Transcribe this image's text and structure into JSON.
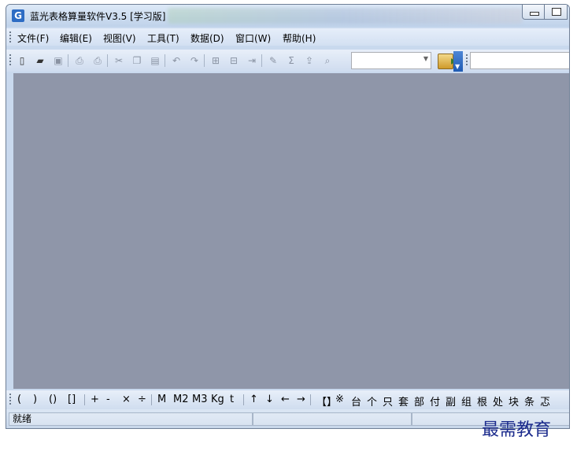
{
  "window": {
    "title": "蓝光表格算量软件V3.5 [学习版]",
    "icon_glyph": "G"
  },
  "menubar": {
    "items": [
      "文件(F)",
      "编辑(E)",
      "视图(V)",
      "工具(T)",
      "数据(D)",
      "窗口(W)",
      "帮助(H)"
    ]
  },
  "toolbar": {
    "buttons": [
      {
        "name": "new-icon",
        "glyph": "▯",
        "enabled": true
      },
      {
        "name": "open-icon",
        "glyph": "▰",
        "enabled": true
      },
      {
        "name": "save-icon",
        "glyph": "▣",
        "enabled": false
      },
      {
        "name": "print-preview-icon",
        "glyph": "⎙",
        "enabled": false
      },
      {
        "name": "print-icon",
        "glyph": "⎙",
        "enabled": false
      },
      {
        "name": "cut-icon",
        "glyph": "✂",
        "enabled": false
      },
      {
        "name": "copy-icon",
        "glyph": "❐",
        "enabled": false
      },
      {
        "name": "paste-icon",
        "glyph": "▤",
        "enabled": false
      },
      {
        "name": "undo-icon",
        "glyph": "↶",
        "enabled": false
      },
      {
        "name": "redo-icon",
        "glyph": "↷",
        "enabled": false
      },
      {
        "name": "insert-row-icon",
        "glyph": "⊞",
        "enabled": false
      },
      {
        "name": "delete-row-icon",
        "glyph": "⊟",
        "enabled": false
      },
      {
        "name": "insert-col-icon",
        "glyph": "⇥",
        "enabled": false
      },
      {
        "name": "brush-icon",
        "glyph": "✎",
        "enabled": false
      },
      {
        "name": "sum-icon",
        "glyph": "Σ",
        "enabled": false
      },
      {
        "name": "export-icon",
        "glyph": "⇪",
        "enabled": false
      },
      {
        "name": "find-icon",
        "glyph": "⌕",
        "enabled": false
      }
    ],
    "combo_value": "",
    "combo2_value": ""
  },
  "symbols": {
    "groups": [
      [
        "(",
        ")",
        "()",
        "[]"
      ],
      [
        "+",
        "-",
        "×",
        "÷"
      ],
      [
        "M",
        "M2",
        "M3",
        "Kg",
        "t"
      ],
      [
        "↑",
        "↓",
        "←",
        "→"
      ],
      [
        "【】",
        "※",
        "台",
        "个",
        "只",
        "套",
        "部",
        "付",
        "副",
        "组",
        "根",
        "处",
        "块",
        "条",
        "忑"
      ]
    ]
  },
  "status": {
    "text": "就绪"
  },
  "watermark": {
    "text": "最需教育"
  },
  "colors": {
    "workspace": "#8f96a9",
    "accent": "#2d6cc4",
    "watermark": "#1a2a8c"
  }
}
